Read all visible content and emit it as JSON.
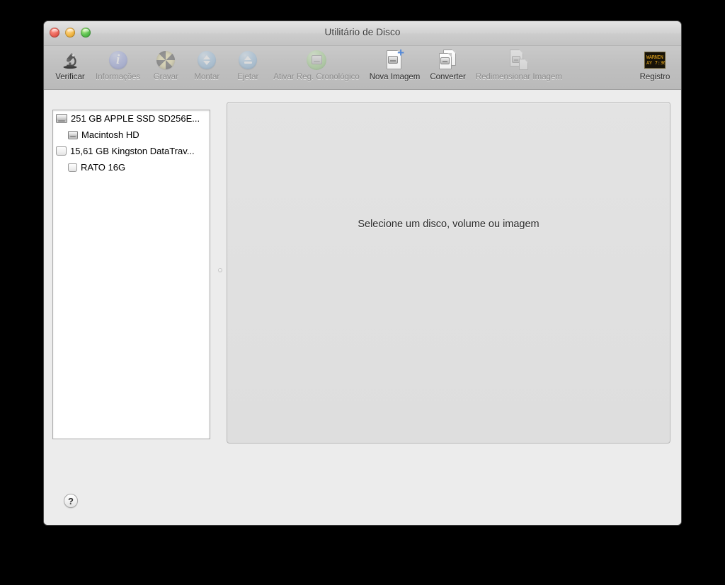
{
  "window": {
    "title": "Utilitário de Disco",
    "controls": {
      "close": "close-button",
      "minimize": "minimize-button",
      "zoom": "zoom-button"
    }
  },
  "toolbar": {
    "items": [
      {
        "label": "Verificar",
        "icon": "microscope-icon",
        "enabled": true
      },
      {
        "label": "Informações",
        "icon": "info-icon",
        "enabled": false
      },
      {
        "label": "Gravar",
        "icon": "burn-icon",
        "enabled": false
      },
      {
        "label": "Montar",
        "icon": "mount-icon",
        "enabled": false
      },
      {
        "label": "Ejetar",
        "icon": "eject-icon",
        "enabled": false
      },
      {
        "label": "Ativar Reg. Cronológico",
        "icon": "journaling-icon",
        "enabled": false
      },
      {
        "label": "Nova Imagem",
        "icon": "new-image-icon",
        "enabled": true
      },
      {
        "label": "Converter",
        "icon": "convert-icon",
        "enabled": true
      },
      {
        "label": "Redimensionar Imagem",
        "icon": "resize-image-icon",
        "enabled": false
      },
      {
        "label": "Registro",
        "icon": "log-icon",
        "enabled": true
      }
    ],
    "log_icon_lines": [
      "WARNIN",
      "AY 7:36"
    ]
  },
  "sidebar": {
    "items": [
      {
        "label": "251 GB APPLE SSD SD256E...",
        "icon": "internal-hard-disk-icon",
        "level": 0
      },
      {
        "label": "Macintosh HD",
        "icon": "volume-icon",
        "level": 1
      },
      {
        "label": "15,61 GB Kingston DataTrav...",
        "icon": "removable-disk-icon",
        "level": 0
      },
      {
        "label": "RATO 16G",
        "icon": "removable-volume-icon",
        "level": 1
      }
    ]
  },
  "main": {
    "empty_message": "Selecione um disco, volume ou imagem"
  },
  "footer": {
    "help_label": "?"
  },
  "colors": {
    "window_background": "#ececec",
    "titlebar_top": "#e4e4e4",
    "toolbar": "#bfbfbf",
    "panel_background": "#e0e0e0",
    "list_background": "#ffffff",
    "text": "#2b2b2b",
    "disabled_text": "#8b8b8b",
    "close_red": "#ed6a5e",
    "minimize_yellow": "#f5bd4f",
    "zoom_green": "#61c454",
    "log_amber": "#e8a81c"
  }
}
